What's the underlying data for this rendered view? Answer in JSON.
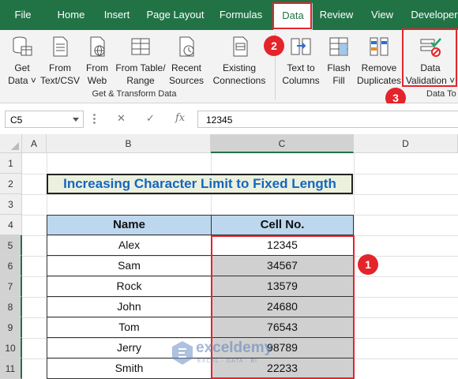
{
  "tabs": [
    "File",
    "Home",
    "Insert",
    "Page Layout",
    "Formulas",
    "Data",
    "Review",
    "View",
    "Developer"
  ],
  "ribbon": {
    "buttons": [
      {
        "line1": "Get",
        "line2": "Data ˅"
      },
      {
        "line1": "From",
        "line2": "Text/CSV"
      },
      {
        "line1": "From",
        "line2": "Web"
      },
      {
        "line1": "From Table/",
        "line2": "Range"
      },
      {
        "line1": "Recent",
        "line2": "Sources"
      },
      {
        "line1": "Existing",
        "line2": "Connections"
      },
      {
        "line1": "Text to",
        "line2": "Columns"
      },
      {
        "line1": "Flash",
        "line2": "Fill"
      },
      {
        "line1": "Remove",
        "line2": "Duplicates"
      },
      {
        "line1": "Data",
        "line2": "Validation ˅"
      }
    ],
    "groups": {
      "get_transform": "Get & Transform Data",
      "data_tools": "Data To"
    }
  },
  "badges": {
    "b1": "1",
    "b2": "2",
    "b3": "3"
  },
  "formula_bar": {
    "name_box": "C5",
    "cancel": "✕",
    "enter": "✓",
    "fx": "fx",
    "value": "12345"
  },
  "columns": [
    "A",
    "B",
    "C",
    "D"
  ],
  "rows": [
    "1",
    "2",
    "3",
    "4",
    "5",
    "6",
    "7",
    "8",
    "9",
    "10",
    "11"
  ],
  "sheet": {
    "title": "Increasing Character Limit to Fixed Length",
    "headers": [
      "Name",
      "Cell No."
    ],
    "data": [
      [
        "Alex",
        "12345"
      ],
      [
        "Sam",
        "34567"
      ],
      [
        "Rock",
        "13579"
      ],
      [
        "John",
        "24680"
      ],
      [
        "Tom",
        "76543"
      ],
      [
        "Jerry",
        "98789"
      ],
      [
        "Smith",
        "22233"
      ]
    ]
  },
  "watermark": {
    "name": "exceldemy",
    "tagline": "EXCEL · DATA · BI"
  },
  "colors": {
    "excel_green": "#217346",
    "highlight_red": "#e4242b",
    "header_blue": "#bdd7ee",
    "title_fill": "#ebf1de",
    "title_text": "#1565c0"
  }
}
